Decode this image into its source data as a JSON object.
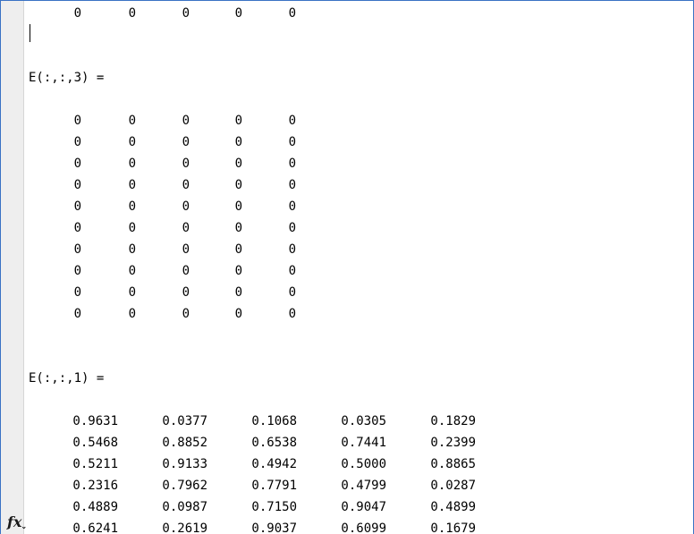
{
  "command_window": {
    "top_partial_row": [
      "0",
      "0",
      "0",
      "0",
      "0"
    ],
    "blocks": [
      {
        "label": "E(:,:,3) =",
        "rows": [
          [
            "0",
            "0",
            "0",
            "0",
            "0"
          ],
          [
            "0",
            "0",
            "0",
            "0",
            "0"
          ],
          [
            "0",
            "0",
            "0",
            "0",
            "0"
          ],
          [
            "0",
            "0",
            "0",
            "0",
            "0"
          ],
          [
            "0",
            "0",
            "0",
            "0",
            "0"
          ],
          [
            "0",
            "0",
            "0",
            "0",
            "0"
          ],
          [
            "0",
            "0",
            "0",
            "0",
            "0"
          ],
          [
            "0",
            "0",
            "0",
            "0",
            "0"
          ],
          [
            "0",
            "0",
            "0",
            "0",
            "0"
          ],
          [
            "0",
            "0",
            "0",
            "0",
            "0"
          ]
        ]
      },
      {
        "label": "E(:,:,1) =",
        "rows": [
          [
            "0.9631",
            "0.0377",
            "0.1068",
            "0.0305",
            "0.1829"
          ],
          [
            "0.5468",
            "0.8852",
            "0.6538",
            "0.7441",
            "0.2399"
          ],
          [
            "0.5211",
            "0.9133",
            "0.4942",
            "0.5000",
            "0.8865"
          ],
          [
            "0.2316",
            "0.7962",
            "0.7791",
            "0.4799",
            "0.0287"
          ],
          [
            "0.4889",
            "0.0987",
            "0.7150",
            "0.9047",
            "0.4899"
          ],
          [
            "0.6241",
            "0.2619",
            "0.9037",
            "0.6099",
            "0.1679"
          ]
        ]
      }
    ],
    "prompt_icon": "fx-icon"
  }
}
